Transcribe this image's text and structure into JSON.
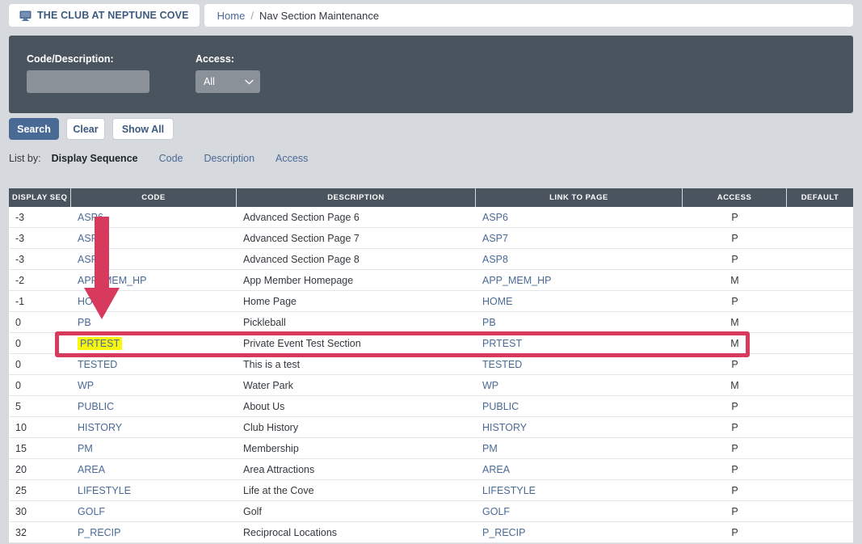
{
  "topbar": {
    "club_name": "THE CLUB AT NEPTUNE COVE",
    "club_icon": "monitor-icon",
    "breadcrumb": {
      "home": "Home",
      "separator": "/",
      "current": "Nav Section Maintenance"
    }
  },
  "search_panel": {
    "code_description_label": "Code/Description:",
    "code_description_value": "",
    "code_description_placeholder": "",
    "access_label": "Access:",
    "access_value": "All",
    "access_options": [
      "All"
    ]
  },
  "buttons": {
    "search": "Search",
    "clear": "Clear",
    "show_all": "Show All"
  },
  "list_by": {
    "caption": "List by:",
    "current": "Display Sequence",
    "options": [
      "Code",
      "Description",
      "Access"
    ]
  },
  "table": {
    "columns": [
      "DISPLAY SEQ",
      "CODE",
      "DESCRIPTION",
      "LINK TO PAGE",
      "ACCESS",
      "DEFAULT"
    ],
    "rows": [
      {
        "seq": "-3",
        "code": "ASP6",
        "description": "Advanced Section Page 6",
        "link": "ASP6",
        "access": "P",
        "default": "",
        "highlighted": false
      },
      {
        "seq": "-3",
        "code": "ASP7",
        "description": "Advanced Section Page 7",
        "link": "ASP7",
        "access": "P",
        "default": "",
        "highlighted": false
      },
      {
        "seq": "-3",
        "code": "ASP8",
        "description": "Advanced Section Page 8",
        "link": "ASP8",
        "access": "P",
        "default": "",
        "highlighted": false
      },
      {
        "seq": "-2",
        "code": "APP_MEM_HP",
        "description": "App Member Homepage",
        "link": "APP_MEM_HP",
        "access": "M",
        "default": "",
        "highlighted": false
      },
      {
        "seq": "-1",
        "code": "HOME",
        "description": "Home Page",
        "link": "HOME",
        "access": "P",
        "default": "",
        "highlighted": false
      },
      {
        "seq": "0",
        "code": "PB",
        "description": "Pickleball",
        "link": "PB",
        "access": "M",
        "default": "",
        "highlighted": false
      },
      {
        "seq": "0",
        "code": "PRTEST",
        "description": "Private Event Test Section",
        "link": "PRTEST",
        "access": "M",
        "default": "",
        "highlighted": true
      },
      {
        "seq": "0",
        "code": "TESTED",
        "description": "This is a test",
        "link": "TESTED",
        "access": "P",
        "default": "",
        "highlighted": false
      },
      {
        "seq": "0",
        "code": "WP",
        "description": "Water Park",
        "link": "WP",
        "access": "M",
        "default": "",
        "highlighted": false
      },
      {
        "seq": "5",
        "code": "PUBLIC",
        "description": "About Us",
        "link": "PUBLIC",
        "access": "P",
        "default": "",
        "highlighted": false
      },
      {
        "seq": "10",
        "code": "HISTORY",
        "description": "Club History",
        "link": "HISTORY",
        "access": "P",
        "default": "",
        "highlighted": false
      },
      {
        "seq": "15",
        "code": "PM",
        "description": "Membership",
        "link": "PM",
        "access": "P",
        "default": "",
        "highlighted": false
      },
      {
        "seq": "20",
        "code": "AREA",
        "description": "Area Attractions",
        "link": "AREA",
        "access": "P",
        "default": "",
        "highlighted": false
      },
      {
        "seq": "25",
        "code": "LIFESTYLE",
        "description": "Life at the Cove",
        "link": "LIFESTYLE",
        "access": "P",
        "default": "",
        "highlighted": false
      },
      {
        "seq": "30",
        "code": "GOLF",
        "description": "Golf",
        "link": "GOLF",
        "access": "P",
        "default": "",
        "highlighted": false
      },
      {
        "seq": "32",
        "code": "P_RECIP",
        "description": "Reciprocal Locations",
        "link": "P_RECIP",
        "access": "P",
        "default": "",
        "highlighted": false
      }
    ]
  },
  "annotations": {
    "arrow": {
      "shape": "down-arrow",
      "color": "#d83a5e"
    },
    "rectangle": {
      "shape": "rounded-rect-outline",
      "color": "#d83a5e"
    },
    "highlight_color": "#f7f70e"
  },
  "colors": {
    "panel_dark": "#4a545f",
    "accent_blue": "#4a6a96",
    "page_background": "#d6d9dd",
    "annotation_red": "#d83a5e"
  }
}
